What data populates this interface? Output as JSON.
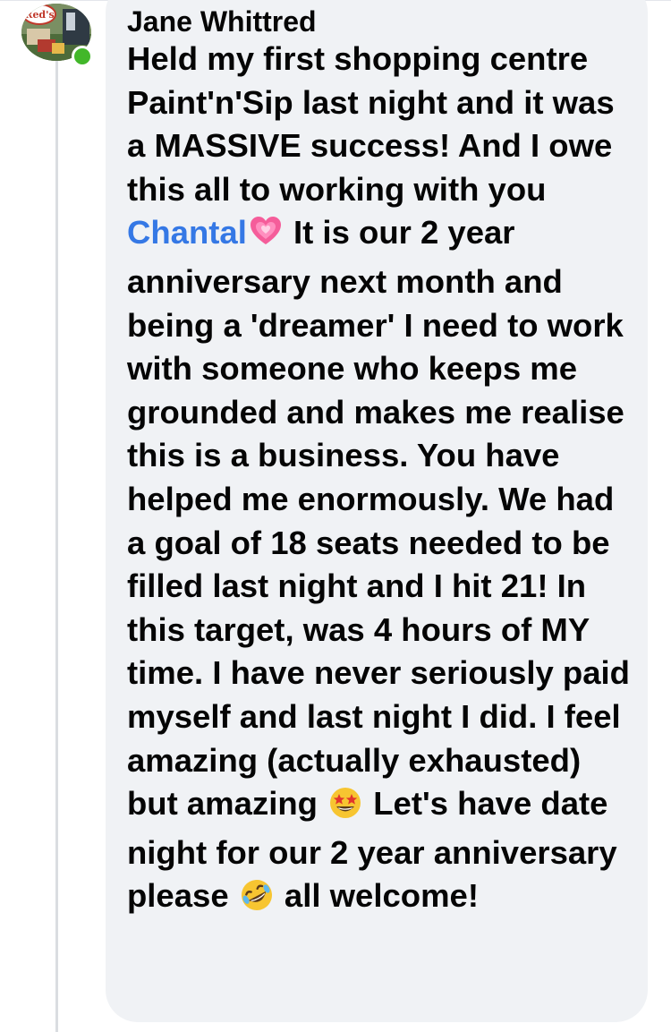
{
  "comment": {
    "author_name": "Jane Whittred",
    "avatar_text": "Red's",
    "text_part1": "Held my first shopping centre Paint'n'Sip last night and it was a MASSIVE success! And I owe this all to working with you ",
    "mention": "Chantal",
    "text_part2": " It is our 2 year anniversary next month and being a 'dreamer' I need to work with someone who keeps me grounded and makes me realise this is a business. You have helped me enormously. We had a goal of 18 seats needed to be filled last night and I hit 21! In this target, was 4 hours of MY time. I have never seriously paid myself and last night I did. I feel amazing (actually exhausted) but amazing ",
    "text_part3": " Let's have date night for our 2 year anniversary please ",
    "text_part4": " all welcome!",
    "emojis": [
      "growing-heart-emoji",
      "star-struck-emoji",
      "rolling-on-floor-laughing-emoji"
    ]
  },
  "colors": {
    "bubble_background": "#f0f2f5",
    "mention_link": "#3578e5",
    "online_status": "#42b72a",
    "text": "#050505"
  }
}
